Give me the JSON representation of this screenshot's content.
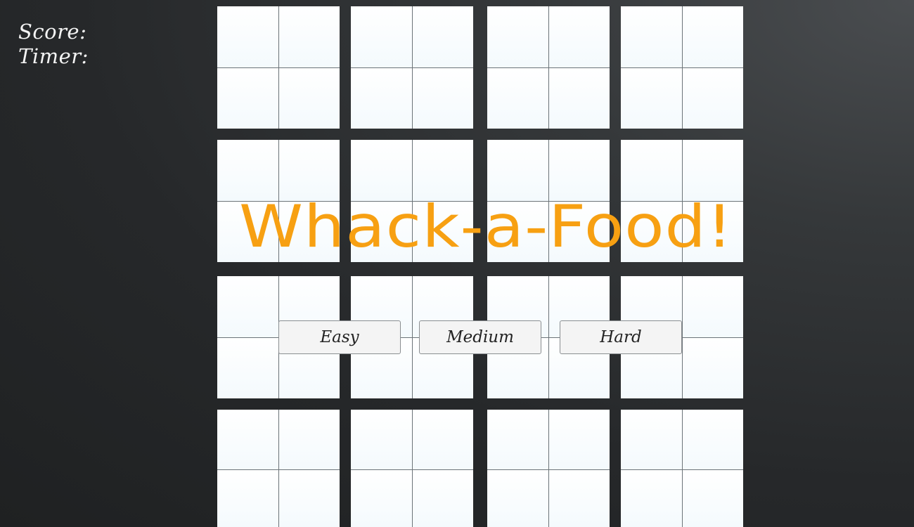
{
  "hud": {
    "score_label": "Score:",
    "timer_label": "Timer:"
  },
  "title": "Whack-a-Food!",
  "difficulty": {
    "easy": "Easy",
    "medium": "Medium",
    "hard": "Hard"
  },
  "colors": {
    "title": "#f7a012",
    "background": "#2a2c2e",
    "hole": "#f4fafd",
    "button": "#f4f4f4"
  }
}
